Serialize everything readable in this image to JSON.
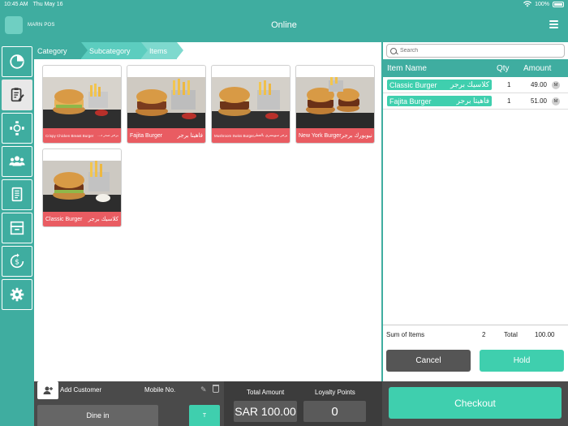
{
  "status_bar": {
    "time": "10:45 AM",
    "date": "Thu May 16",
    "battery": "100%"
  },
  "header": {
    "logo_text": "MARN POS",
    "title": "Online"
  },
  "sidebar": {
    "items": [
      {
        "name": "dashboard"
      },
      {
        "name": "orders",
        "active": true
      },
      {
        "name": "tables"
      },
      {
        "name": "customers"
      },
      {
        "name": "reports"
      },
      {
        "name": "inventory"
      },
      {
        "name": "payments"
      },
      {
        "name": "settings"
      }
    ]
  },
  "breadcrumb": {
    "category": "Category",
    "subcategory": "Subcategory",
    "items": "Items"
  },
  "products": [
    {
      "name_en": "Crispy Chicken Breast Burger",
      "name_ar": "برجر صدر د..."
    },
    {
      "name_en": "Fajita Burger",
      "name_ar": "فاهيتا برجر"
    },
    {
      "name_en": "Mushroom Swiss Burger",
      "name_ar": "برجر سويسري بالفطر"
    },
    {
      "name_en": "New York Burger",
      "name_ar": "نيويورك برجر"
    },
    {
      "name_en": "Classic Burger",
      "name_ar": "كلاسيك برجر"
    }
  ],
  "search": {
    "placeholder": "Search"
  },
  "order_table": {
    "headers": {
      "name": "Item Name",
      "qty": "Qty",
      "amount": "Amount"
    },
    "rows": [
      {
        "name_en": "Classic Burger",
        "name_ar": "كلاسيك برجر",
        "qty": "1",
        "amount": "49.00",
        "modifier": "M"
      },
      {
        "name_en": "Fajita Burger",
        "name_ar": "فاهيتا برجر",
        "qty": "1",
        "amount": "51.00",
        "modifier": "M"
      }
    ]
  },
  "summary": {
    "label": "Sum of Items",
    "count": "2",
    "total_label": "Total",
    "total": "100.00"
  },
  "actions": {
    "cancel": "Cancel",
    "hold": "Hold",
    "checkout": "Checkout"
  },
  "customer": {
    "add_label": "Add Customer",
    "mobile_label": "Mobile No."
  },
  "order_type": {
    "dine_in": "Dine in",
    "table_btn": "T"
  },
  "totals": {
    "total_label": "Total Amount",
    "total_value": "SAR 100.00",
    "loyalty_label": "Loyalty Points",
    "loyalty_value": "0"
  },
  "colors": {
    "primary": "#3fada0",
    "accent": "#3fcfae",
    "label_red": "#e95c62",
    "dark_bar": "#4a4a4a"
  }
}
